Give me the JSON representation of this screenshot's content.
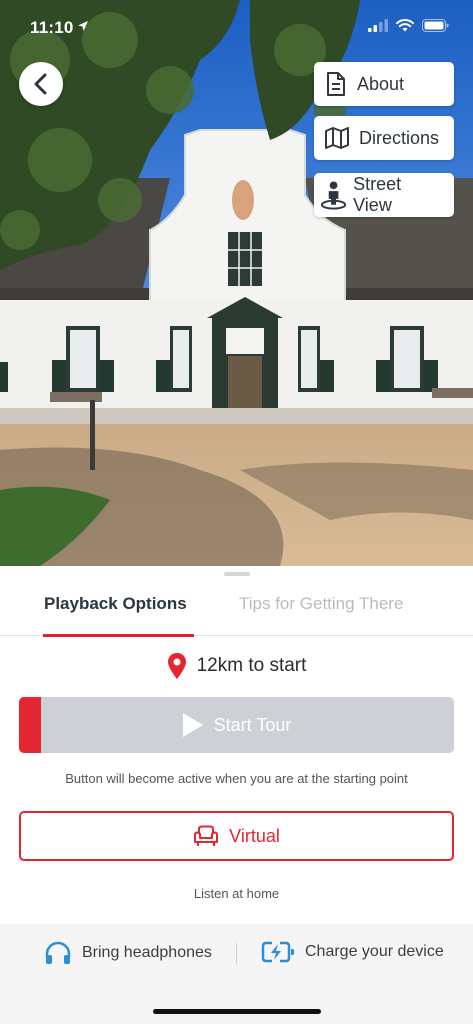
{
  "status_bar": {
    "time": "11:10"
  },
  "hero": {
    "chips": {
      "about": {
        "label": "About",
        "icon": "document-icon"
      },
      "directions": {
        "label": "Directions",
        "icon": "map-icon"
      },
      "street_view": {
        "label": "Street View",
        "icon": "street-view-icon"
      }
    }
  },
  "tabs": [
    {
      "label": "Playback Options",
      "active": true
    },
    {
      "label": "Tips for Getting There",
      "active": false
    }
  ],
  "distance": {
    "text": "12km to start",
    "icon": "location-pin-icon"
  },
  "start_tour": {
    "label": "Start Tour",
    "icon": "play-icon",
    "progress_fraction": 0.05,
    "enabled": false
  },
  "start_hint": "Button will become active when you are at the starting point",
  "virtual": {
    "label": "Virtual",
    "icon": "armchair-icon"
  },
  "listen_text": "Listen at home",
  "tips": [
    {
      "label": "Bring headphones",
      "icon": "headphones-icon"
    },
    {
      "label": "Charge your device",
      "icon": "battery-charging-icon"
    }
  ],
  "colors": {
    "accent": "#e3262f",
    "accent_icon": "#2a8fd6",
    "disabled": "#cdd0d5",
    "inactive_tab": "#b8bcc2"
  }
}
